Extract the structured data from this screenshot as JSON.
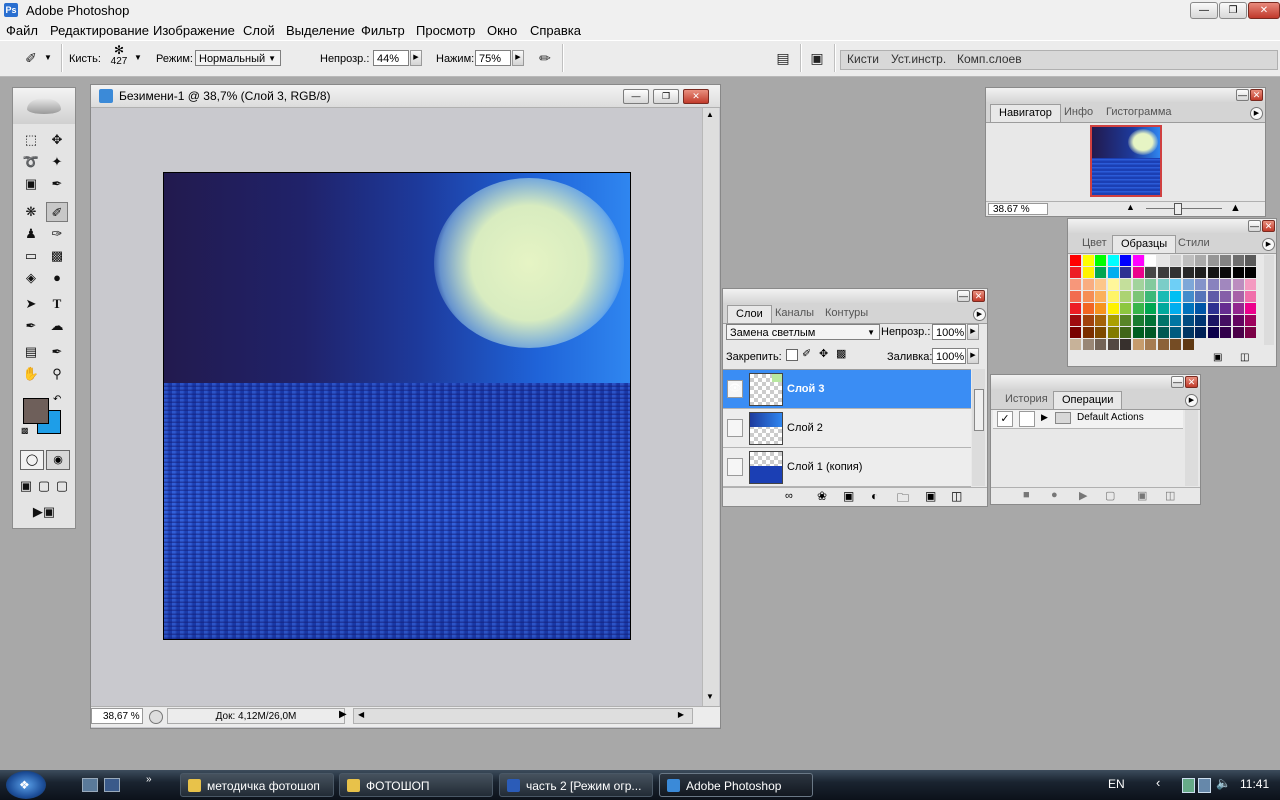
{
  "app": {
    "title": "Adobe Photoshop",
    "icon": "photoshop-icon"
  },
  "window_controls": {
    "minimize": "minimize-icon",
    "restore": "restore-icon",
    "close": "close-icon"
  },
  "menu": [
    "Файл",
    "Редактирование",
    "Изображение",
    "Слой",
    "Выделение",
    "Фильтр",
    "Просмотр",
    "Окно",
    "Справка"
  ],
  "options": {
    "brush_label": "Кисть:",
    "brush_size": "427",
    "mode_label": "Режим:",
    "mode_value": "Нормальный",
    "opacity_label": "Непрозр.:",
    "opacity_value": "44%",
    "flow_label": "Нажим:",
    "flow_value": "75%",
    "well_tabs": [
      "Кисти",
      "Уст.инстр.",
      "Комп.слоев"
    ]
  },
  "document": {
    "title": "Безимени-1 @ 38,7% (Слой 3, RGB/8)",
    "zoom": "38,67 %",
    "doc_info": "Док: 4,12M/26,0M"
  },
  "colors": {
    "foreground": "#6e5f5a",
    "background": "#1e9ee8",
    "selected_layer": "#3a8df4"
  },
  "navigator": {
    "tabs": [
      "Навигатор",
      "Инфо",
      "Гистограмма"
    ],
    "zoom": "38.67 %"
  },
  "swatches_panel": {
    "tabs": [
      "Цвет",
      "Образцы",
      "Стили"
    ],
    "rows": [
      [
        "#ff0000",
        "#ffff00",
        "#00ff00",
        "#00ffff",
        "#0000ff",
        "#ff00ff",
        "#ffffff",
        "#e6e6e6",
        "#d2d2d2",
        "#bebebe",
        "#aaaaaa",
        "#969696",
        "#828282",
        "#6e6e6e",
        "#5a5a5a"
      ],
      [
        "#ed1c24",
        "#fff200",
        "#00a651",
        "#00aeef",
        "#2e3192",
        "#ec008c",
        "#464646",
        "#3c3c3c",
        "#323232",
        "#282828",
        "#1e1e1e",
        "#141414",
        "#0a0a0a",
        "#000000",
        "#000000"
      ],
      [
        "#f7977a",
        "#f9ad81",
        "#fdc68a",
        "#fff79a",
        "#c4df9b",
        "#a2d39c",
        "#82ca9d",
        "#7bcdc8",
        "#6ecff6",
        "#7ea7d8",
        "#8493ca",
        "#8882be",
        "#a187be",
        "#bc8dbf",
        "#f49ac1"
      ],
      [
        "#f26c4f",
        "#f68e55",
        "#fbaf5c",
        "#fff467",
        "#acd372",
        "#7cc576",
        "#3bb878",
        "#1abbb4",
        "#00bff3",
        "#438ccb",
        "#5574b9",
        "#605ca8",
        "#855fa8",
        "#a763a8",
        "#f06eaa"
      ],
      [
        "#ed1c24",
        "#f26522",
        "#f7941d",
        "#fff200",
        "#8dc73f",
        "#39b54a",
        "#00a651",
        "#00a99d",
        "#00aeef",
        "#0072bc",
        "#0054a6",
        "#2e3192",
        "#662d91",
        "#92278f",
        "#ec008c"
      ],
      [
        "#9e0b0f",
        "#a0410d",
        "#a36209",
        "#aba000",
        "#598527",
        "#1a7b30",
        "#007236",
        "#00746b",
        "#0076a3",
        "#004b80",
        "#003471",
        "#1b1464",
        "#440e62",
        "#630460",
        "#9e005d"
      ],
      [
        "#790000",
        "#7b2e00",
        "#7d4900",
        "#827b00",
        "#406618",
        "#005e20",
        "#005826",
        "#005952",
        "#005b7f",
        "#003663",
        "#002157",
        "#0d004c",
        "#32004b",
        "#4b0049",
        "#7b0046"
      ],
      [
        "#c7b299",
        "#998675",
        "#736357",
        "#534741",
        "#37302d",
        "#c69c6d",
        "#a67c52",
        "#8c6239",
        "#754c24",
        "#603913"
      ]
    ]
  },
  "layers": {
    "tabs": [
      "Слои",
      "Каналы",
      "Контуры"
    ],
    "blend_mode": "Замена светлым",
    "opacity_label": "Непрозр.:",
    "opacity_value": "100%",
    "lock_label": "Закрепить:",
    "fill_label": "Заливка:",
    "fill_value": "100%",
    "items": [
      {
        "name": "Слой 3",
        "selected": true,
        "visible": true
      },
      {
        "name": "Слой 2",
        "selected": false,
        "visible": false
      },
      {
        "name": "Слой 1 (копия)",
        "selected": false,
        "visible": false
      }
    ]
  },
  "actions": {
    "tabs": [
      "История",
      "Операции"
    ],
    "items": [
      {
        "name": "Default Actions",
        "checked": true
      }
    ]
  },
  "taskbar": {
    "buttons": [
      "методичка фотошоп",
      "ФОТОШОП",
      "часть 2 [Режим огр...",
      "Adobe Photoshop"
    ],
    "language": "EN",
    "clock": "11:41"
  }
}
